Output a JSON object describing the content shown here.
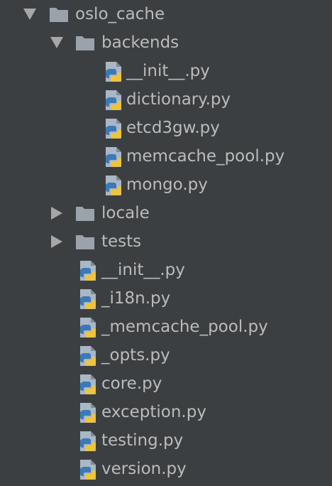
{
  "tree": {
    "root": {
      "label": "oslo_cache",
      "expanded": true,
      "icon": "folder-icon"
    },
    "backends": {
      "label": "backends",
      "expanded": true,
      "icon": "folder-icon",
      "files": [
        {
          "label": "__init__.py",
          "icon": "python-file-icon"
        },
        {
          "label": "dictionary.py",
          "icon": "python-file-icon"
        },
        {
          "label": "etcd3gw.py",
          "icon": "python-file-icon"
        },
        {
          "label": "memcache_pool.py",
          "icon": "python-file-icon"
        },
        {
          "label": "mongo.py",
          "icon": "python-file-icon"
        }
      ]
    },
    "locale": {
      "label": "locale",
      "expanded": false,
      "icon": "folder-icon"
    },
    "tests": {
      "label": "tests",
      "expanded": false,
      "icon": "folder-icon"
    },
    "files": [
      {
        "label": "__init__.py",
        "icon": "python-file-icon"
      },
      {
        "label": "_i18n.py",
        "icon": "python-file-icon"
      },
      {
        "label": "_memcache_pool.py",
        "icon": "python-file-icon"
      },
      {
        "label": "_opts.py",
        "icon": "python-file-icon"
      },
      {
        "label": "core.py",
        "icon": "python-file-icon"
      },
      {
        "label": "exception.py",
        "icon": "python-file-icon"
      },
      {
        "label": "testing.py",
        "icon": "python-file-icon"
      },
      {
        "label": "version.py",
        "icon": "python-file-icon"
      }
    ]
  },
  "colors": {
    "background": "#3c3f41",
    "text": "#bbbbbb",
    "arrow": "#a7a7a7",
    "folder": "#9aa3ab",
    "file_page": "#a9b7c6",
    "python_blue": "#3b79b8",
    "python_yellow": "#f0c43a"
  }
}
